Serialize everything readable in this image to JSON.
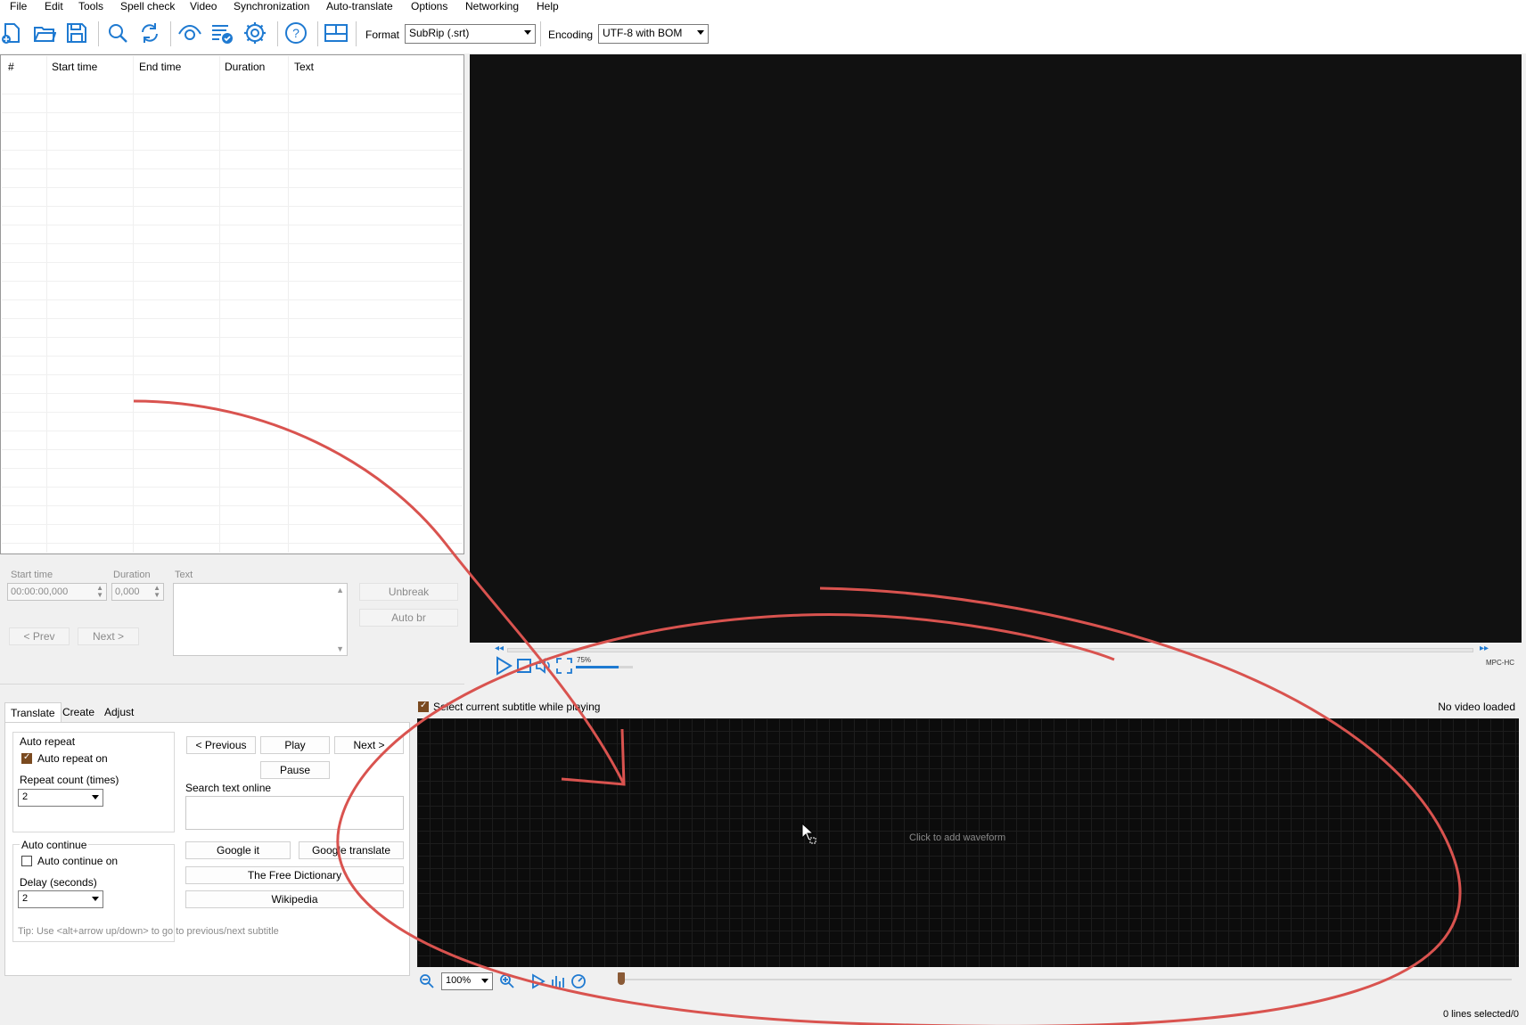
{
  "menu": [
    "File",
    "Edit",
    "Tools",
    "Spell check",
    "Video",
    "Synchronization",
    "Auto-translate",
    "Options",
    "Networking",
    "Help"
  ],
  "toolbar": {
    "icons": [
      "new-file-icon",
      "open-folder-icon",
      "save-icon",
      "find-icon",
      "replace-icon",
      "visual-sync-icon",
      "spell-check-icon",
      "settings-icon",
      "help-icon",
      "layout-icon"
    ],
    "format_label": "Format",
    "format_value": "SubRip (.srt)",
    "encoding_label": "Encoding",
    "encoding_value": "UTF-8 with BOM"
  },
  "grid": {
    "columns": [
      "#",
      "Start time",
      "End time",
      "Duration",
      "Text"
    ],
    "rows": []
  },
  "editor": {
    "start_time_label": "Start time",
    "start_time_value": "00:00:00,000",
    "duration_label": "Duration",
    "duration_value": "0,000",
    "text_label": "Text",
    "unbreak": "Unbreak",
    "auto_br": "Auto br",
    "prev": "< Prev",
    "next": "Next >"
  },
  "video": {
    "volume": "75%",
    "player": "MPC-HC"
  },
  "tabs": [
    "Translate",
    "Create",
    "Adjust"
  ],
  "translate": {
    "auto_repeat_title": "Auto repeat",
    "auto_repeat_on": "Auto repeat on",
    "auto_repeat_checked": true,
    "repeat_count_label": "Repeat count (times)",
    "repeat_count_value": "2",
    "auto_continue_title": "Auto continue",
    "auto_continue_on": "Auto continue on",
    "auto_continue_checked": false,
    "delay_label": "Delay (seconds)",
    "delay_value": "2",
    "previous": "< Previous",
    "play": "Play",
    "next": "Next >",
    "pause": "Pause",
    "search_label": "Search text online",
    "search_value": "",
    "google_it": "Google it",
    "google_translate": "Google translate",
    "free_dictionary": "The Free Dictionary",
    "wikipedia": "Wikipedia",
    "tip": "Tip: Use <alt+arrow up/down> to go to previous/next subtitle"
  },
  "waveform": {
    "select_current": "Select current subtitle while playing",
    "select_checked": true,
    "no_video": "No video loaded",
    "click_to_add": "Click to add waveform",
    "zoom": "100%"
  },
  "status": {
    "lines_selected": "0 lines selected/0"
  },
  "colors": {
    "accent": "#1f7ad1",
    "annotation": "#d9534f",
    "video_bg": "#111111"
  }
}
